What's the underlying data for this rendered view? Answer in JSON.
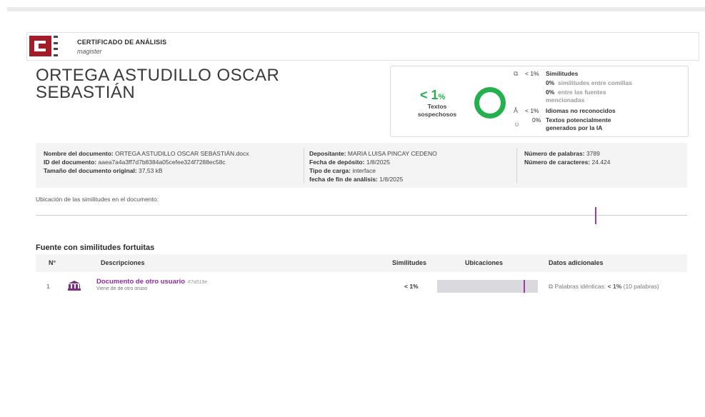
{
  "header": {
    "logo_icon": "cnet-logo-icon",
    "brand_color": "#a31c2a",
    "title": "CERTIFICADO DE ANÁLISIS",
    "subtitle": "magister"
  },
  "author_name": "ORTEGA ASTUDILLO OSCAR SEBASTIÁN",
  "summary": {
    "percent": "< 1",
    "percent_sign": "%",
    "label_line1": "Textos",
    "label_line2": "sospechosos",
    "ring_color": "#22b14c",
    "similitudes_value": "< 1%",
    "similitudes_label": "Similitudes",
    "entre_comillas_value": "0%",
    "entre_comillas_label": "similitudes entre comillas",
    "fuentes_value": "0%",
    "fuentes_label_line1": "entre las fuentes",
    "fuentes_label_line2": "mencionadas",
    "idiomas_value": "< 1%",
    "idiomas_label": "Idiomas no reconocidos",
    "ia_value": "0%",
    "ia_label_line1": "Textos potencialmente",
    "ia_label_line2": "generados por la IA"
  },
  "meta": {
    "doc_name_label": "Nombre del documento:",
    "doc_name": "ORTEGA ASTUDILLO OSCAR SEBASTIÁN.docx",
    "doc_id_label": "ID del documento:",
    "doc_id": "aaea7a4a3ff7d7b8384a05cefee324f7288ec58c",
    "size_label": "Tamaño del documento original:",
    "size": "37,53 kB",
    "depositante_label": "Depositante:",
    "depositante": "MARIA LUISA PINCAY CEDENO",
    "fecha_deposito_label": "Fecha de depósito:",
    "fecha_deposito": "1/8/2025",
    "tipo_carga_label": "Tipo de carga:",
    "tipo_carga": "interface",
    "fecha_fin_label": "fecha de fin de análisis:",
    "fecha_fin": "1/8/2025",
    "palabras_label": "Número de palabras:",
    "palabras": "3789",
    "caracteres_label": "Número de caracteres:",
    "caracteres": "24.424"
  },
  "location": {
    "label": "Ubicación de las similitudes en el documento:",
    "marker_color": "#9b3ea5"
  },
  "sources": {
    "title": "Fuente con similitudes fortuitas",
    "columns": [
      "N°",
      "Descripciones",
      "Similitudes",
      "Ubicaciones",
      "Datos adicionales"
    ],
    "rows": [
      {
        "num": "1",
        "icon": "institution-icon",
        "title": "Documento de otro usuario",
        "id": "#7a519e",
        "subtitle": "Viene de de otro grupo",
        "similitud": "< 1%",
        "extra_label": "Palabras idénticas:",
        "extra_value": "< 1%",
        "extra_count": "(10 palabras)"
      }
    ]
  }
}
